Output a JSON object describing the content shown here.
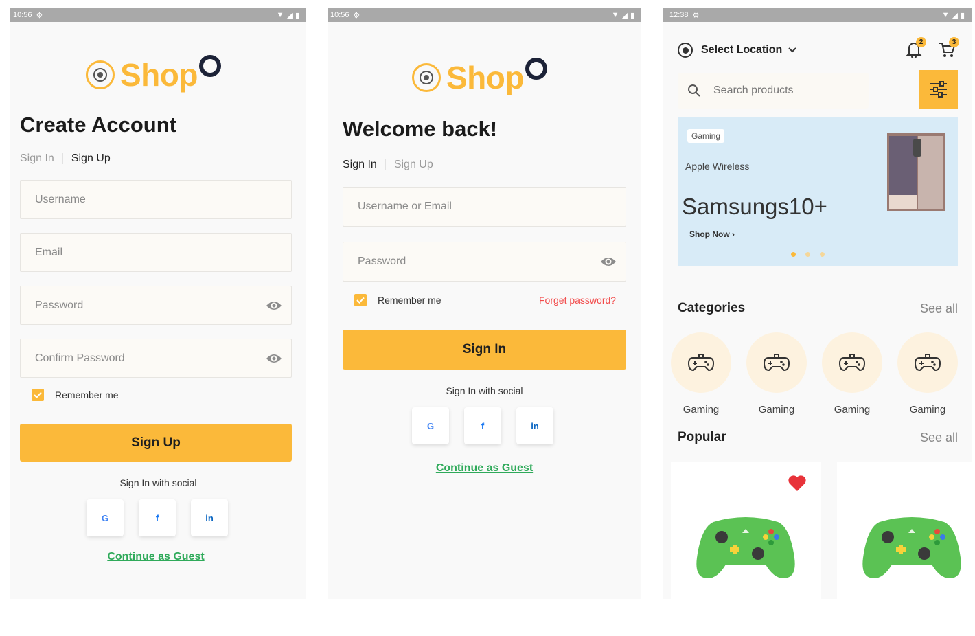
{
  "screens": {
    "signup": {
      "status": {
        "time": "10:56"
      },
      "logo": {
        "word": "Shop"
      },
      "title": "Create Account",
      "tabs": {
        "signin": "Sign In",
        "signup": "Sign Up"
      },
      "fields": {
        "username": "Username",
        "email": "Email",
        "password": "Password",
        "confirm": "Confirm Password"
      },
      "remember": "Remember me",
      "button": "Sign Up",
      "social_label": "Sign In with social",
      "social": {
        "google": "G",
        "facebook": "f",
        "linkedin": "in"
      },
      "guest": "Continue as Guest"
    },
    "signin": {
      "status": {
        "time": "10:56"
      },
      "logo": {
        "word": "Shop"
      },
      "title": "Welcome back!",
      "tabs": {
        "signin": "Sign In",
        "signup": "Sign Up"
      },
      "fields": {
        "username": "Username or Email",
        "password": "Password"
      },
      "remember": "Remember me",
      "forgot": "Forget password?",
      "button": "Sign In",
      "social_label": "Sign In with social",
      "social": {
        "google": "G",
        "facebook": "f",
        "linkedin": "in"
      },
      "guest": "Continue as Guest"
    },
    "home": {
      "status": {
        "time": "12:38"
      },
      "location": "Select Location",
      "notif_count": "2",
      "cart_count": "3",
      "search_placeholder": "Search products",
      "banner": {
        "tag": "Gaming",
        "subtitle": "Apple Wireless",
        "headline": "Samsungs10+",
        "cta": "Shop Now",
        "active_dot": 0
      },
      "categories": {
        "title": "Categories",
        "see_all": "See all",
        "items": [
          "Gaming",
          "Gaming",
          "Gaming",
          "Gaming"
        ]
      },
      "popular": {
        "title": "Popular",
        "see_all": "See all"
      }
    }
  },
  "colors": {
    "accent": "#fbb93a",
    "navy": "#1c2237",
    "guest_link": "#2faa5a",
    "forgot_link": "#f24a4a",
    "banner_bg": "#d8ebf7",
    "controller": "#5bc254",
    "heart": "#e8333a"
  }
}
